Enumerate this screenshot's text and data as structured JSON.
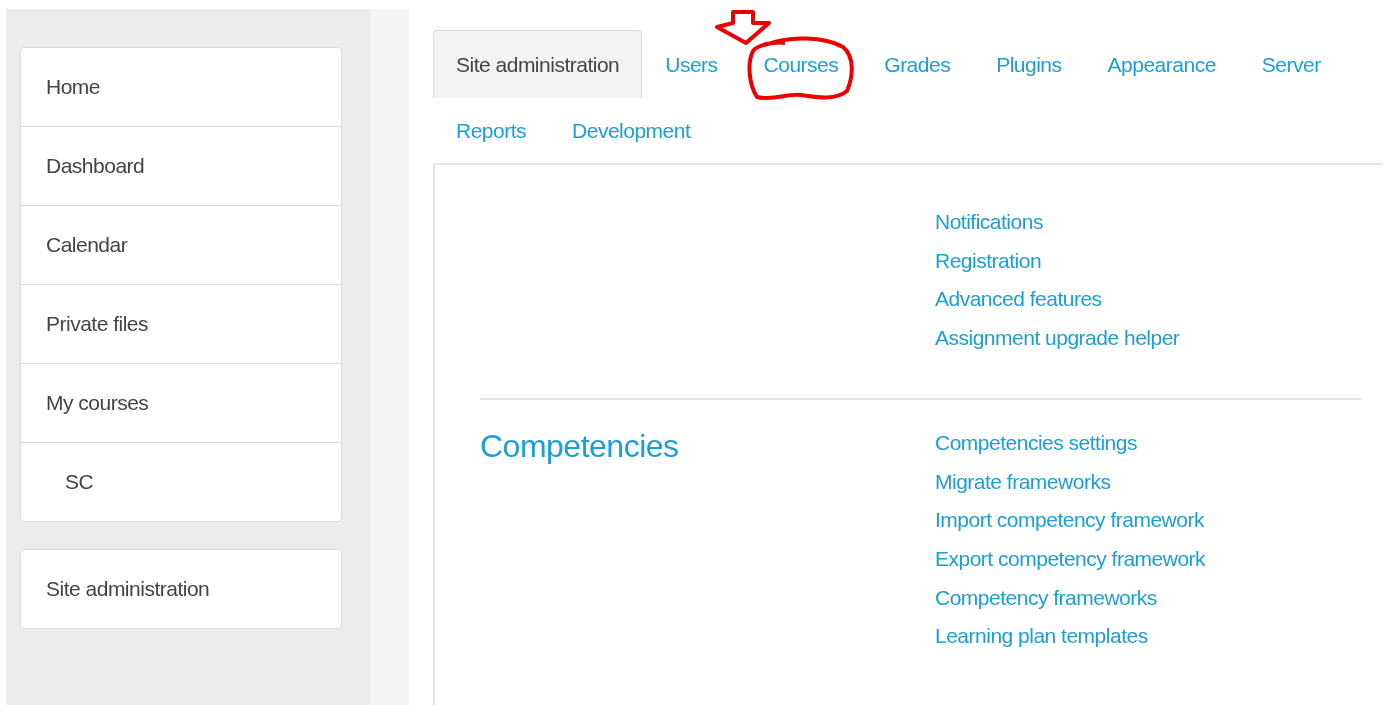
{
  "sidebar": {
    "groups": [
      {
        "items": [
          {
            "label": "Home"
          },
          {
            "label": "Dashboard"
          },
          {
            "label": "Calendar"
          },
          {
            "label": "Private files"
          },
          {
            "label": "My courses",
            "children": [
              {
                "label": "SC"
              }
            ]
          }
        ]
      },
      {
        "items": [
          {
            "label": "Site administration"
          }
        ]
      }
    ]
  },
  "tabs": [
    {
      "label": "Site administration",
      "selected": true,
      "annotated": false
    },
    {
      "label": "Users",
      "selected": false,
      "annotated": false
    },
    {
      "label": "Courses",
      "selected": false,
      "annotated": true
    },
    {
      "label": "Grades",
      "selected": false,
      "annotated": false
    },
    {
      "label": "Plugins",
      "selected": false,
      "annotated": false
    },
    {
      "label": "Appearance",
      "selected": false,
      "annotated": false
    },
    {
      "label": "Server",
      "selected": false,
      "annotated": false
    },
    {
      "label": "Reports",
      "selected": false,
      "annotated": false
    },
    {
      "label": "Development",
      "selected": false,
      "annotated": false
    }
  ],
  "sections": [
    {
      "links": [
        "Notifications",
        "Registration",
        "Advanced features",
        "Assignment upgrade helper"
      ]
    },
    {
      "heading": "Competencies",
      "links": [
        "Competencies settings",
        "Migrate frameworks",
        "Import competency framework",
        "Export competency framework",
        "Competency frameworks",
        "Learning plan templates"
      ]
    }
  ]
}
